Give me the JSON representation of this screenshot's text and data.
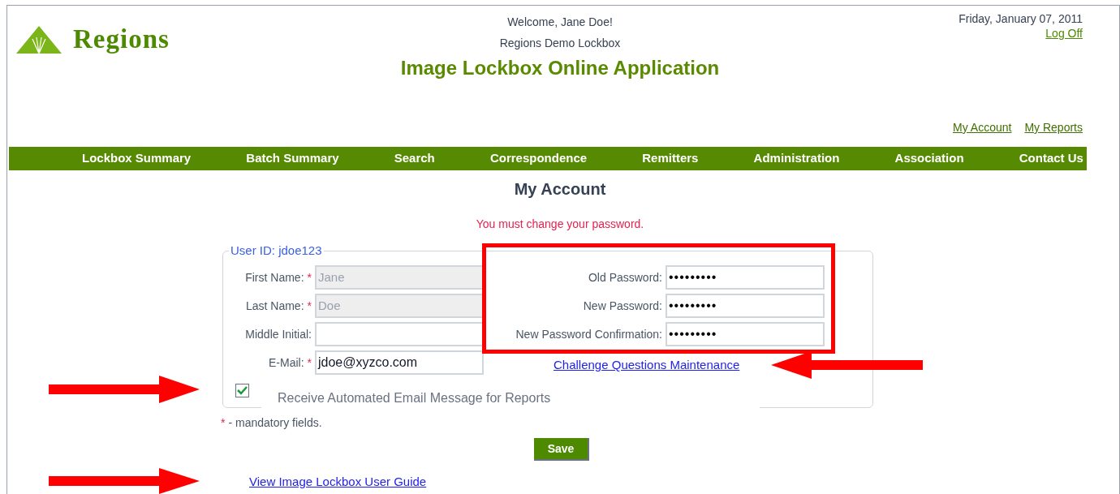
{
  "header": {
    "logo": "Regions",
    "welcome": "Welcome, Jane Doe!",
    "lockbox": "Regions Demo Lockbox",
    "title": "Image Lockbox Online Application",
    "date": "Friday, January 07, 2011",
    "log_off": "Log Off",
    "links": [
      "My Account",
      "My Reports"
    ]
  },
  "nav": [
    "Lockbox Summary",
    "Batch Summary",
    "Search",
    "Correspondence",
    "Remitters",
    "Administration",
    "Association",
    "Contact Us"
  ],
  "page_title": "My Account",
  "message": "You must change your password.",
  "form": {
    "legend": "User ID: jdoe123",
    "left_fields": [
      {
        "label": "First Name:",
        "required": true,
        "value": "Jane",
        "disabled": true
      },
      {
        "label": "Last Name:",
        "required": true,
        "value": "Doe",
        "disabled": true
      },
      {
        "label": "Middle Initial:",
        "required": false,
        "disabled": false
      },
      {
        "label": "E-Mail:",
        "required": true,
        "value": "jdoe@xyzco.com",
        "disabled": false
      }
    ],
    "password_fields": [
      {
        "label": "Old Password:",
        "value": "•••••••••"
      },
      {
        "label": "New Password:",
        "value": "•••••••••"
      },
      {
        "label": "New Password Confirmation:",
        "value": "•••••••••"
      }
    ],
    "challenge_link": "Challenge Questions Maintenance",
    "email_reports": {
      "label": "Receive Automated Email Message for Reports",
      "checked": true
    }
  },
  "mandatory_note": {
    "mark": "*",
    "text": "- mandatory fields."
  },
  "save_button": "Save",
  "guide_link": "View Image Lockbox User Guide"
}
